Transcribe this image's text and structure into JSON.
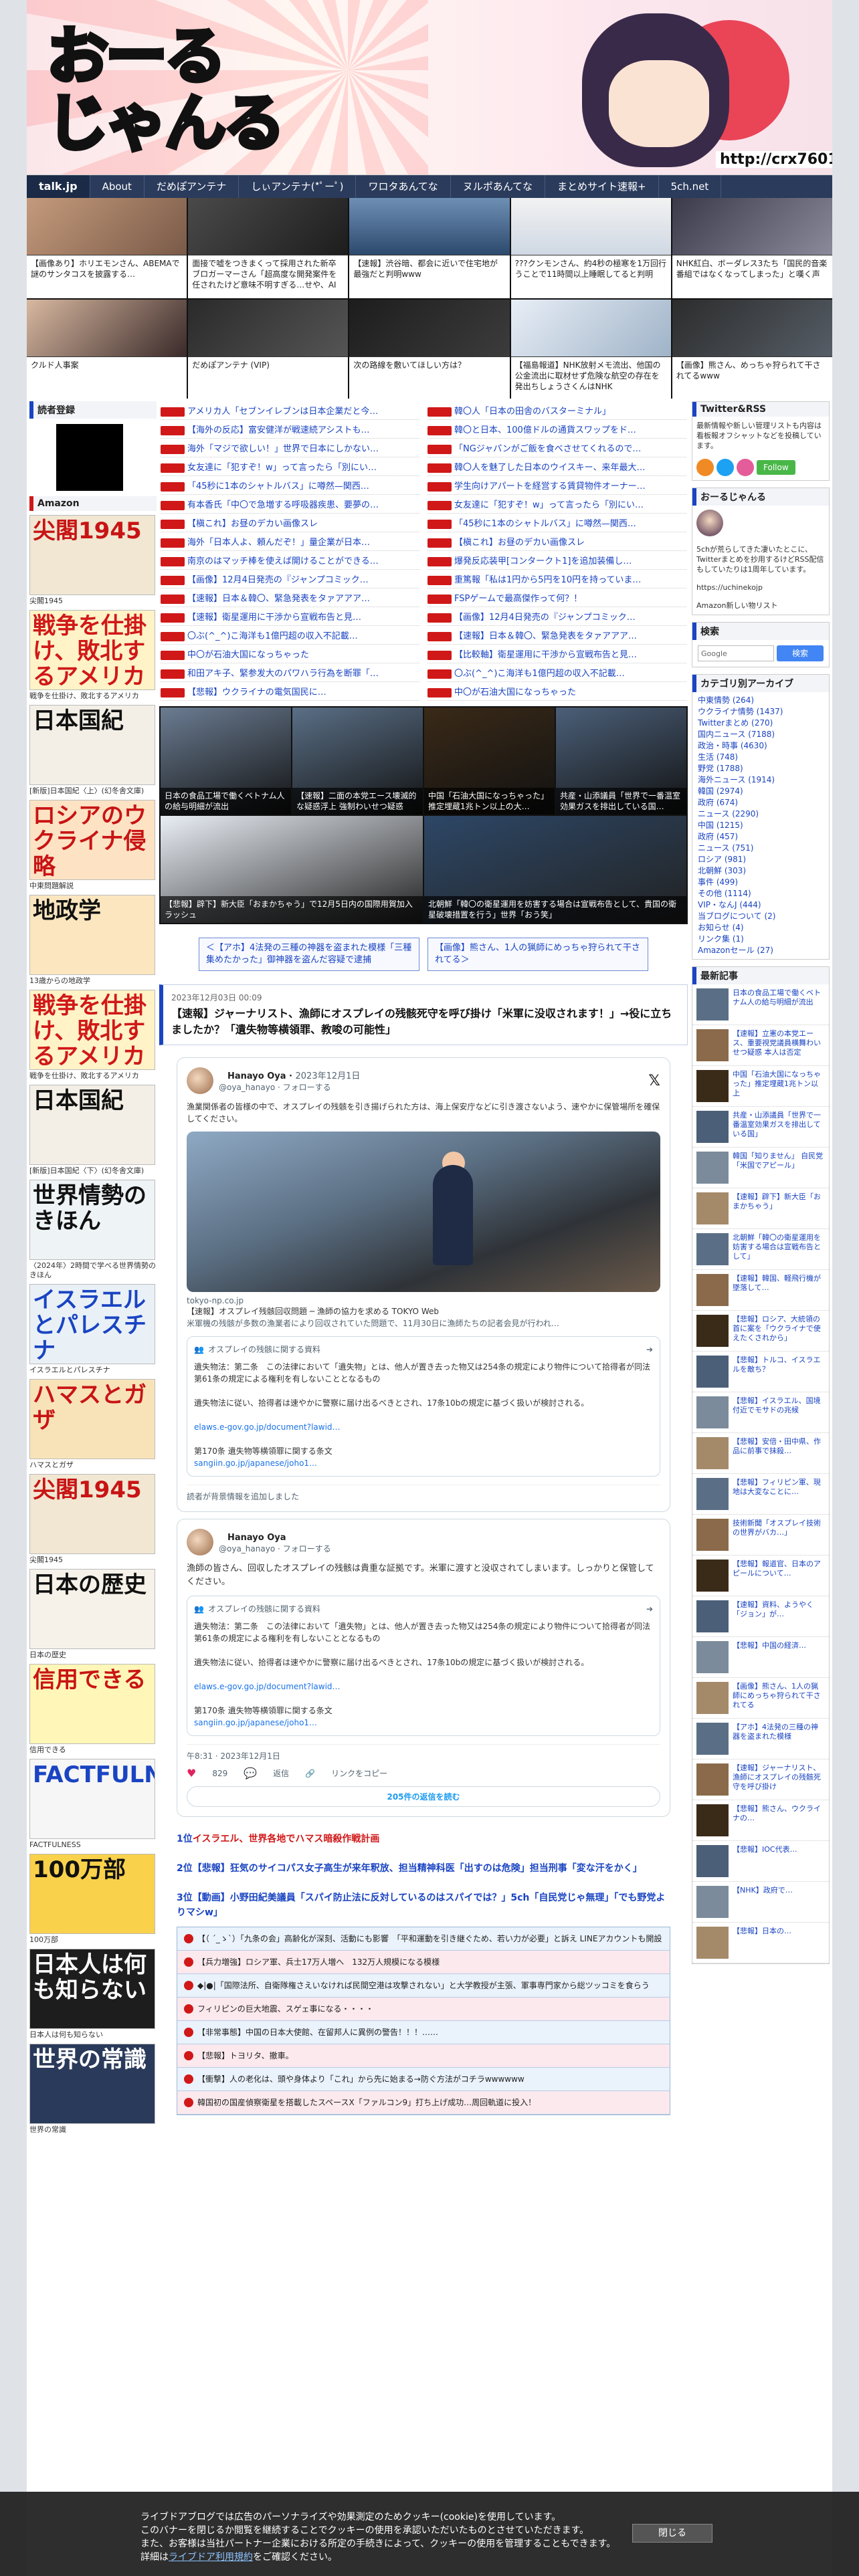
{
  "site": {
    "logo_line1": "おーる",
    "logo_line2": "じゃんる",
    "url": "http://crx7601.com",
    "nav": [
      "talk.jp",
      "About",
      "だめぽアンテナ",
      "しぃアンテナ(*ﾟーﾟ)",
      "ワロタあんてな",
      "ヌルポあんてな",
      "まとめサイト速報+",
      "5ch.net"
    ]
  },
  "top_thumbs": [
    "【画像あり】ホリエモンさん、ABEMAで謎のサンタコスを披露する…",
    "面接で嘘をつきまくって採用された新卒ブロガーマーさん「超高度な開発案件を任されたけど意味不明すぎる…せや、AI",
    "【速報】渋谷暗、都会に近いで住宅地が最強だと判明www",
    "???クンモンさん、約4秒の極寒を1万回行うことで11時間以上睡眠してると判明",
    "NHK紅白、ボーダレス3たち「国民的音楽番組ではなくなってしまった」と嘆く声",
    "クルド人事案",
    "だめぽアンテナ (VIP)",
    "次の路線を敷いてほしい方は？",
    "【福島報道】NHK放射メモ流出、他国の公金流出に取材せず危険な航空の存在を発出ちしょうさくんはNHK",
    "【画像】熊さん、めっちゃ狩られて干されてるwww"
  ],
  "left": {
    "register_head": "読者登録",
    "amazon_head": "Amazon",
    "books": [
      {
        "title": "尖閣1945",
        "caption": "尖閣1945",
        "color": "#c81414",
        "bg": "#f1e7d2"
      },
      {
        "title": "戦争を仕掛け、敗北するアメリカ",
        "caption": "戦争を仕掛け、敗北するアメリカ",
        "color": "#d01818",
        "bg": "#fff3c7"
      },
      {
        "title": "日本国紀",
        "caption": "[新版]日本国紀〈上〉(幻冬舎文庫)",
        "color": "#111",
        "bg": "#f3efe6"
      },
      {
        "title": "ロシアのウクライナ侵略",
        "caption": "中東問題解説",
        "color": "#c81414",
        "bg": "#fde3c4"
      },
      {
        "title": "地政学",
        "caption": "13歳からの地政学",
        "color": "#111",
        "bg": "#fbe6bf"
      },
      {
        "title": "戦争を仕掛け、敗北するアメリカ",
        "caption": "戦争を仕掛け、敗北するアメリカ",
        "color": "#d01818",
        "bg": "#fff3c7"
      },
      {
        "title": "日本国紀",
        "caption": "[新版]日本国紀〈下〉(幻冬舎文庫)",
        "color": "#111",
        "bg": "#f3efe6"
      },
      {
        "title": "世界情勢のきほん",
        "caption": "〈2024年〉2時間で学べる世界情勢のきほん",
        "color": "#111",
        "bg": "#eef3f6"
      },
      {
        "title": "イスラエルとパレスチナ",
        "caption": "イスラエルとパレスチナ",
        "color": "#1a44c2",
        "bg": "#e9f1f7"
      },
      {
        "title": "ハマスとガザ",
        "caption": "ハマスとガザ",
        "color": "#c81414",
        "bg": "#f8e3b9"
      },
      {
        "title": "尖閣1945",
        "caption": "尖閣1945",
        "color": "#c81414",
        "bg": "#f1e7d2"
      },
      {
        "title": "日本の歴史",
        "caption": "日本の歴史",
        "color": "#111",
        "bg": "#f6f2ea"
      },
      {
        "title": "信用できる",
        "caption": "信用できる",
        "color": "#c81414",
        "bg": "#fff6b8"
      },
      {
        "title": "FACTFULNESS",
        "caption": "FACTFULNESS",
        "color": "#1a44c2",
        "bg": "#f6f6f6"
      },
      {
        "title": "100万部",
        "caption": "100万部",
        "color": "#111",
        "bg": "#f9d14b"
      },
      {
        "title": "日本人は何も知らない",
        "caption": "日本人は何も知らない",
        "color": "#fff",
        "bg": "#1d1d1d"
      },
      {
        "title": "世界の常識",
        "caption": "世界の常識",
        "color": "#fff",
        "bg": "#2a3a5a"
      }
    ]
  },
  "headlines_left": [
    "アメリカ人「セブンイレブンは日本企業だと今…",
    "【海外の反応】富安健洋が戦速続アシストも…",
    "海外「マジで欲しい！」世界で日本にしかない…",
    "女友達に「犯すぞ！w」って言ったら「別にい…",
    "「45秒に1本のシャトルバス」に噂然—関西…",
    "有本香氏「中〇で急増する呼吸器疾患、要夢の…",
    "【槇これ】お昼のデカい画像スレ",
    "海外「日本人よ、頼んだぞ！」量企業が日本…",
    "南京のはマッチ棒を使えば開けることができる…",
    "【画像】12月4日発売の『ジャンプコミック…",
    "【速報】日本＆韓〇、緊急発表をタァアアア…",
    "【速報】衛星運用に干渉から宣戦布告と見…",
    "〇ぶ(^_^)こ海洋も1億円超の収入不記載…",
    "中〇が石油大国になっちゃった",
    "和田アキ子、緊参发大のパワハラ行為を断罪「…",
    "【悲報】ウクライナの電気国民に…"
  ],
  "headlines_right": [
    "韓〇人「日本の田舎のバスターミナル」",
    "韓〇と日本、100億ドルの通貨スワップをド…",
    "「NGジャパンがご飯を食べさせてくれるので…",
    "韓〇人を魅了した日本のウイスキー、来年最大…",
    "学生向けアパートを経営する賃貸物件オーナー…",
    "女友達に「犯すぞ！w」って言ったら「別にい…",
    "「45秒に1本のシャトルバス」に噂然—関西…",
    "【槇これ】お昼のデカい画像スレ",
    "爆発反応装甲[コンタークト1]を追加装備し…",
    "重篤報「私は1円から5円を10円を持っていま…",
    "FSPゲームで最高傑作って何？！",
    "【画像】12月4日発売の『ジャンプコミック…",
    "【速報】日本＆韓〇、緊急発表をタァアアア…",
    "【比較軸】衛星運用に干渉から宣戦布告と見…",
    "〇ぶ(^_^)こ海洋も1億円超の収入不記載…",
    "中〇が石油大国になっちゃった"
  ],
  "features_top": [
    {
      "cap": "日本の食品工場で働くベトナム人の給与明細が流出",
      "bg": "#6b7c92"
    },
    {
      "cap": "【速報】二面の本党エース壊滅的な疑惑浮上 強制わいせつ疑惑",
      "bg": "#5a6f86"
    },
    {
      "cap": "中国「石油大国になっちゃった」推定埋蔵1兆トン以上の大…",
      "bg": "#3a2a18"
    },
    {
      "cap": "共産・山添議員「世界で一番温室効果ガスを排出している国…",
      "bg": "#4b5f78"
    }
  ],
  "features_bottom": [
    {
      "cap": "【悲報】辟下】新大臣「おまかちゃう」で12月5日内の国際用賀加入ラッシュ",
      "bg": "#e9eef5"
    },
    {
      "cap": "北朝鮮「韓〇の衛星運用を妨害する場合は宣戦布告として、貴国の衛星破壊措置を行う」世界「おう笑」",
      "bg": "#2d4766"
    }
  ],
  "page_nav": {
    "prev": "＜【アホ】4法発の三種の神器を盗まれた模様「三種集めたかった」御神器を盗んだ容疑で逮捕",
    "next": "【画像】熊さん、1人の猟師にめっちゃ狩られて干されてる＞"
  },
  "article": {
    "date": "2023年12月03日 00:09",
    "title": "【速報】ジャーナリスト、漁師にオスプレイの残骸死守を呼び掛け「米軍に没収されます！」→役に立ちましたか？「遺失物等横領罪、教唆の可能性」"
  },
  "tweet1": {
    "name": "　Hanayo Oya",
    "date": "2023年12月1日",
    "handle": "@oya_hanayo · フォローする",
    "text": "漁業関係者の皆様の中で、オスプレイの残骸を引き揚げられた方は、海上保安庁などに引き渡さないよう、速やかに保管場所を確保してください。",
    "link": "tokyo-np.co.jp",
    "linktitle": "【速報】オスプレイ残骸回収問題 ─ 漁師の協力を求める TOKYO Web",
    "linkdesc": "米軍機の残骸が多数の漁業者により回収されていた問題で、11月30日に漁師たちの記者会見が行われ…",
    "quote_head": "オスプレイの残骸に関する資料",
    "quote_body1": "遺失物法：第二条　この法律において「遺失物」とは、他人が置き去った物又は254条の規定により物件について拾得者が同法第61条の規定による権利を有しないこととなるもの",
    "quote_body2": "遺失物法に従い、拾得者は速やかに警察に届け出るべきとされ、17条10bの規定に基づく扱いが検討される。",
    "quote_link1": "elaws.e-gov.go.jp/document?lawid…",
    "quote_body3": "第170条 遺失物等横領罪に関する条文",
    "quote_link2": "sangiin.go.jp/japanese/joho1…",
    "footer": "読者が背景情報を追加しました"
  },
  "tweet2": {
    "name": "　Hanayo Oya",
    "handle": "@oya_hanayo · フォローする",
    "text": "漁師の皆さん、回収したオスプレイの残骸は貴重な証拠です。米軍に渡すと没収されてしまいます。しっかりと保管してください。",
    "quote_head": "オスプレイの残骸に関する資料",
    "quote_body1": "遺失物法：第二条　この法律において「遺失物」とは、他人が置き去った物又は254条の規定により物件について拾得者が同法第61条の規定による権利を有しないこととなるもの",
    "quote_body2": "遺失物法に従い、拾得者は速やかに警察に届け出るべきとされ、17条10bの規定に基づく扱いが検討される。",
    "quote_link1": "elaws.e-gov.go.jp/document?lawid…",
    "quote_body3": "第170条 遺失物等横領罪に関する条文",
    "quote_link2": "sangiin.go.jp/japanese/joho1…",
    "time": "午8:31 · 2023年12月1日",
    "likes": "829",
    "reply": "返信",
    "copy": "リンクをコピー",
    "more": "205件の返信を読む"
  },
  "ranking": [
    {
      "no": "1位",
      "text": "イスラエル、世界各地でハマス暗殺作戦計画",
      "cls": "red"
    },
    {
      "no": "2位",
      "text": "【悲報】狂気のサイコパス女子高生が来年釈放、担当精神科医「出すのは危険」担当刑事「変な汗をかく」",
      "cls": "blue"
    },
    {
      "no": "3位",
      "text": "【動画】小野田紀美議員「スパイ防止法に反対しているのはスパイでは？」5ch「自民党じゃ無理」「でも野党よりマシw」",
      "cls": "blue"
    }
  ],
  "ranklist": [
    "【（ ´_ゝ`）「九条の会」高齢化が深刻、活動にも影響　「平和運動を引き継ぐため、若い力が必要」と訴え LINEアカウントも開設",
    "【兵力増強】ロシア軍、兵士17万人増へ　132万人規模になる模様",
    "◆|●|「国際法所、自衛隊権さえいなければ民間空港は攻撃されない」と大学教授が主張、軍事専門家から総ツッコミを食らう",
    "フィリピンの巨大地震、スゲェ事になる・・・・",
    "【非常事態】中国の日本大使館、在留邦人に異例の警告！！！……",
    "【悲報】トヨリタ、撤車。",
    "【衝撃】人の老化は、頭や身体より「これ」から先に始まる→防ぐ方法がコチラwwwwww",
    "韓国初の国産偵察衛星を搭載したスペースX「ファルコン9」打ち上げ成功…周回軌道に投入！"
  ],
  "right": {
    "twitter_head": "Twitter&RSS",
    "twitter_body": "最新情報や新しい管理リストも内容は看板報オフシャットなどを投稿しています。",
    "follow": "Follow",
    "profile_head": "おーるじゃんる",
    "profile_body": "5chが荒らしてきた凄いたとこに、Twitterまとめを抄用するけどRSS配信もしていたりは1周年しています。",
    "profile_url": "https://uchinekojp",
    "amazon_link": "Amazon新しい物リスト",
    "search_head": "検索",
    "search_placeholder": "Google",
    "search_btn": "検索",
    "cat_head": "カテゴリ別アーカイブ",
    "cats": [
      "中東情勢 (264)",
      "ウクライナ情勢 (1437)",
      "Twitterまとめ (270)",
      "国内ニュース (7188)",
      "政治・時事 (4630)",
      "生活 (748)",
      "野党 (1788)",
      "海外ニュース (1914)",
      "韓国 (2974)",
      "政府 (674)",
      "ニュース (2290)",
      "中国 (1215)",
      "政府 (457)",
      "ニュース (751)",
      "ロシア (981)",
      "北朝鮮 (303)",
      "事件 (499)",
      "その他 (1114)",
      "VIP・なんJ (444)",
      "当ブログについて (2)",
      "お知らせ (4)",
      "リンク集 (1)",
      "Amazonセール (27)"
    ],
    "recent_head": "最新記事",
    "recent": [
      "日本の食品工場で働くベトナム人の給与明細が流出",
      "【速報】立憲の本党エース、重要視党議員横舞わいせつ疑惑 本人は否定",
      "中国「石油大国になっちゃった」推定埋蔵1兆トン以上",
      "共産・山添議員「世界で一番温室効果ガスを排出している国」",
      "韓国「知りません」 自民党「米国でアピール」",
      "【速報】辟下】新大臣「おまかちゃう」",
      "北朝鮮「韓〇の衛星運用を妨害する場合は宣戦布告として」",
      "【速報】韓国、軽飛行機が墜落して…",
      "【悲報】ロシア、大統領の首に案を「ウクライナで使えたくされから」",
      "【悲報】トルコ、イスラエルを敵ち？",
      "【悲報】イスラエル、国境付近でモサドの兆候",
      "【悲報】安倍・田中県、作品に前事で抹殺…",
      "【悲報】フィリピン軍、現地は大変なことに…",
      "技術新聞「オスプレイ技術の世界がバカ…」",
      "【悲報】報道官、日本のアピールについて…",
      "【速報】資料、ようやく「ジョン」が…",
      "【悲報】中国の経済…",
      "【画像】熊さん、1人の猟師にめっちゃ狩られて干されてる",
      "【アホ】4法発の三種の神器を盗まれた模様",
      "【速報】ジャーナリスト、漁師にオスプレイの残骸死守を呼び掛け",
      "【悲報】熊さん、ウクライナの…",
      "【悲報】IOC代表…",
      "【NHK】政府で…",
      "【悲報】日本の…"
    ]
  },
  "cookie": {
    "line1": "ライブドアブログでは広告のパーソナライズや効果測定のためクッキー(cookie)を使用しています。",
    "line2": "このバナーを閉じるか閲覧を継続することでクッキーの使用を承認いただいたものとさせていただきます。",
    "line3": "また、お客様は当社パートナー企業における所定の手続きによって、クッキーの使用を管理することもできます。",
    "line4_pre": "詳細は",
    "line4_link": "ライブドア利用規約",
    "line4_post": "をご確認ください。",
    "button": "閉じる"
  }
}
